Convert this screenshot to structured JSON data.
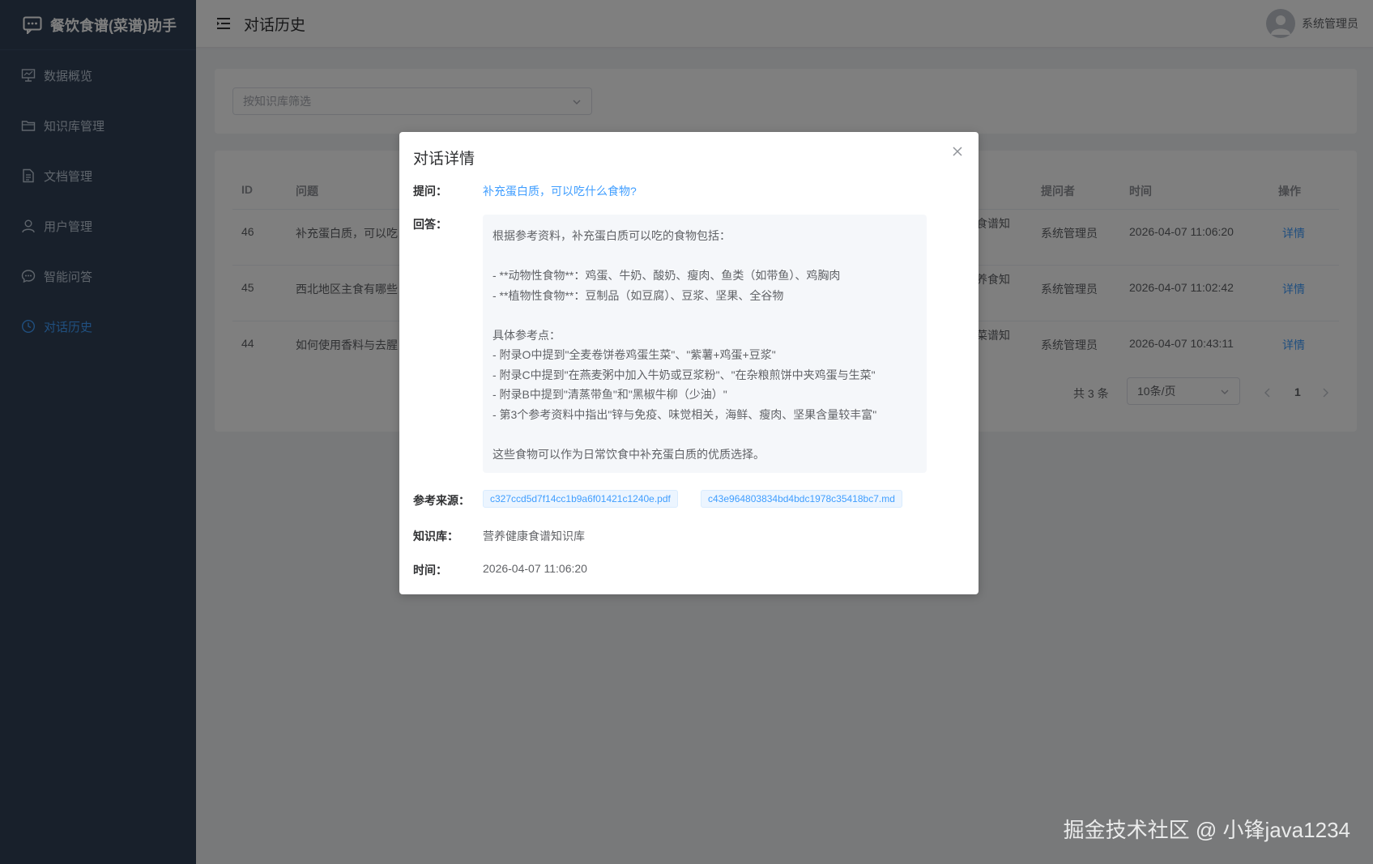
{
  "app": {
    "title": "餐饮食谱(菜谱)助手"
  },
  "sidebar": {
    "items": [
      {
        "label": "数据概览",
        "icon": "monitor-icon"
      },
      {
        "label": "知识库管理",
        "icon": "folder-icon"
      },
      {
        "label": "文档管理",
        "icon": "document-icon"
      },
      {
        "label": "用户管理",
        "icon": "user-icon"
      },
      {
        "label": "智能问答",
        "icon": "chat-icon"
      },
      {
        "label": "对话历史",
        "icon": "clock-icon",
        "active": true
      }
    ]
  },
  "header": {
    "page_title": "对话历史",
    "username": "系统管理员"
  },
  "filter": {
    "placeholder": "按知识库筛选"
  },
  "table": {
    "headers": {
      "id": "ID",
      "question": "问题",
      "asker": "提问者",
      "time": "时间",
      "action": "操作"
    },
    "rows": [
      {
        "id": "46",
        "question": "补充蛋白质，可以吃",
        "kb_fragment": "食谱知",
        "asker": "系统管理员",
        "time": "2026-04-07 11:06:20",
        "action": "详情"
      },
      {
        "id": "45",
        "question": "西北地区主食有哪些",
        "kb_fragment": "养食知",
        "asker": "系统管理员",
        "time": "2026-04-07 11:02:42",
        "action": "详情"
      },
      {
        "id": "44",
        "question": "如何使用香料与去腥",
        "kb_fragment": "菜谱知",
        "asker": "系统管理员",
        "time": "2026-04-07 10:43:11",
        "action": "详情"
      }
    ]
  },
  "pagination": {
    "total": "共 3 条",
    "page_size": "10条/页",
    "current_page": "1"
  },
  "dialog": {
    "title": "对话详情",
    "question_label": "提问：",
    "question": "补充蛋白质，可以吃什么食物?",
    "answer_label": "回答：",
    "answer_lines": [
      "根据参考资料，补充蛋白质可以吃的食物包括：",
      "",
      "- **动物性食物**：鸡蛋、牛奶、酸奶、瘦肉、鱼类（如带鱼）、鸡胸肉",
      "- **植物性食物**：豆制品（如豆腐）、豆浆、坚果、全谷物",
      "",
      "具体参考点：",
      "- 附录O中提到\"全麦卷饼卷鸡蛋生菜\"、\"紫薯+鸡蛋+豆浆\"",
      "- 附录C中提到\"在燕麦粥中加入牛奶或豆浆粉\"、\"在杂粮煎饼中夹鸡蛋与生菜\"",
      "- 附录B中提到\"清蒸带鱼\"和\"黑椒牛柳（少油）\"",
      "- 第3个参考资料中指出\"锌与免疫、味觉相关，海鲜、瘦肉、坚果含量较丰富\"",
      "",
      "这些食物可以作为日常饮食中补充蛋白质的优质选择。"
    ],
    "sources_label": "参考来源：",
    "sources": [
      "c327ccd5d7f14cc1b9a6f01421c1240e.pdf",
      "c43e964803834bd4bdc1978c35418bc7.md"
    ],
    "kb_label": "知识库：",
    "kb_value": "营养健康食谱知识库",
    "time_label": "时间：",
    "time_value": "2026-04-07 11:06:20"
  },
  "watermark": "掘金技术社区 @ 小锋java1234",
  "colors": {
    "sidebar_bg": "#304156",
    "accent": "#409eff"
  }
}
